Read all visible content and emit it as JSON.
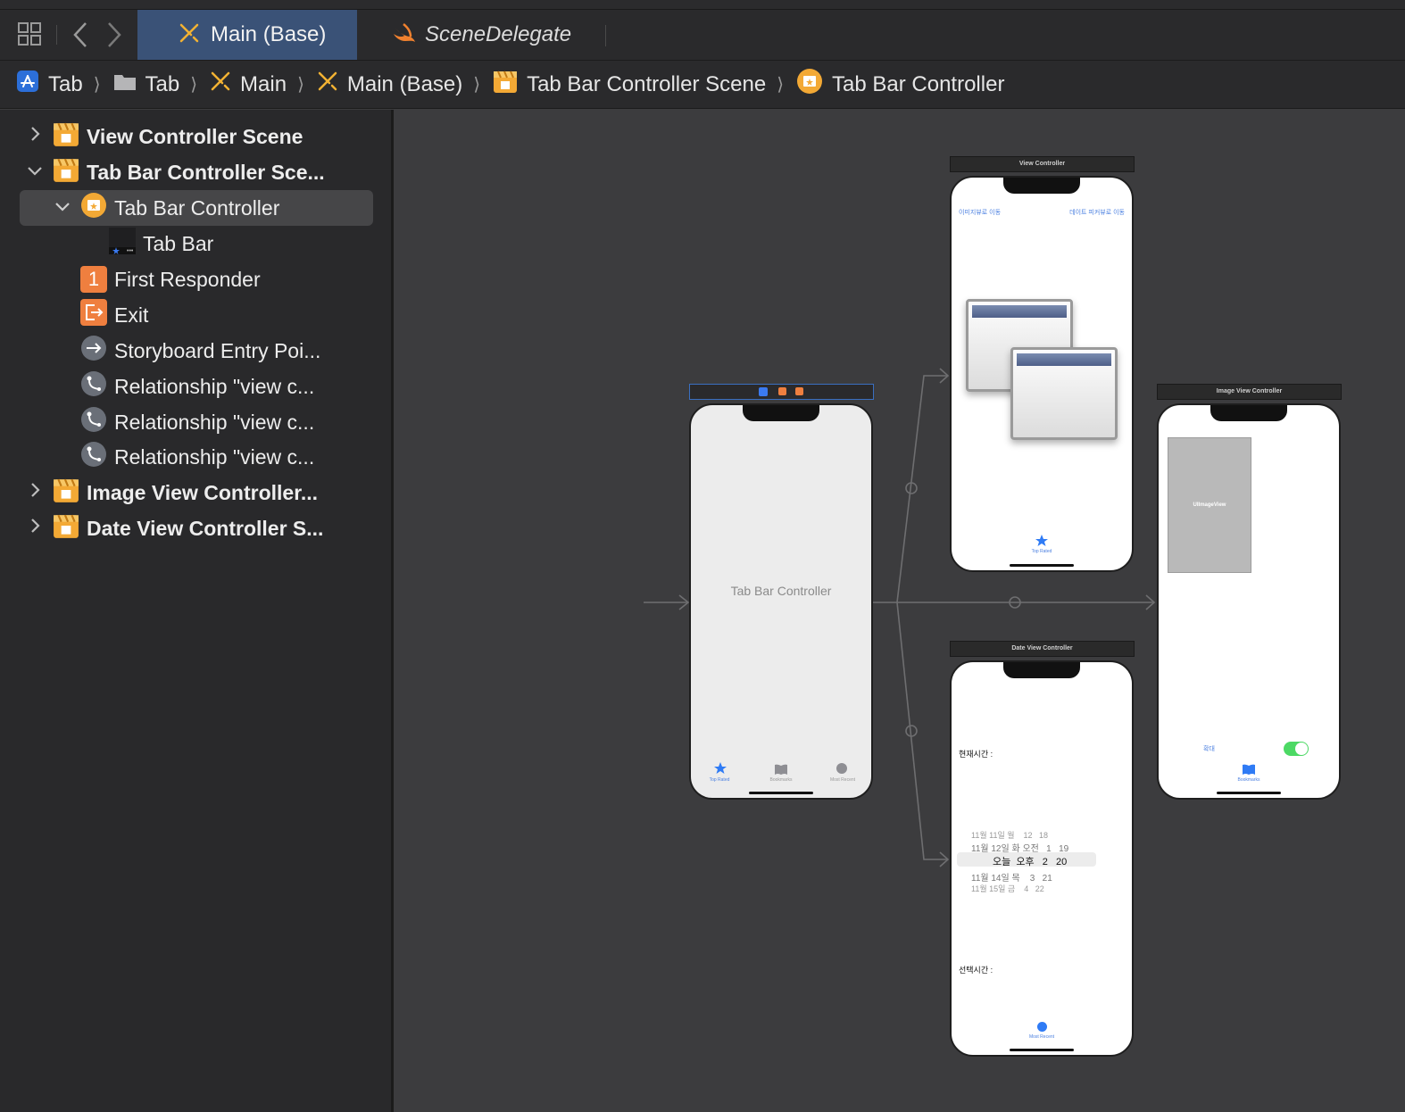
{
  "toolbar": {
    "tabs": [
      {
        "label": "Main (Base)",
        "active": true
      },
      {
        "label": "SceneDelegate",
        "active": false
      }
    ]
  },
  "breadcrumb": [
    {
      "label": "Tab",
      "icon": "app-icon"
    },
    {
      "label": "Tab",
      "icon": "folder-icon"
    },
    {
      "label": "Main",
      "icon": "storyboard-icon"
    },
    {
      "label": "Main (Base)",
      "icon": "storyboard-icon"
    },
    {
      "label": "Tab Bar Controller Scene",
      "icon": "scene-icon"
    },
    {
      "label": "Tab Bar Controller",
      "icon": "tab-bar-controller-icon"
    }
  ],
  "outline": {
    "items": [
      {
        "label": "View Controller Scene"
      },
      {
        "label": "Tab Bar Controller Sce..."
      },
      {
        "label": "Tab Bar Controller"
      },
      {
        "label": "Tab Bar"
      },
      {
        "label": "First Responder"
      },
      {
        "label": "Exit"
      },
      {
        "label": "Storyboard Entry Poi..."
      },
      {
        "label": "Relationship \"view c..."
      },
      {
        "label": "Relationship \"view c..."
      },
      {
        "label": "Relationship \"view c..."
      },
      {
        "label": "Image View Controller..."
      },
      {
        "label": "Date View Controller S..."
      }
    ],
    "first_responder_badge": "1"
  },
  "canvas": {
    "tab_bar_controller": {
      "title": "Tab Bar Controller",
      "tabs": [
        "Top Rated",
        "Bookmarks",
        "Most Recent"
      ]
    },
    "view_controller": {
      "scene_title": "View Controller",
      "left_link": "이미지뷰로 이동",
      "right_link": "데이트 피커뷰로 이동",
      "tab": "Top Rated"
    },
    "image_view_controller": {
      "scene_title": "Image View Controller",
      "image_label": "UIImageView",
      "zoom_label": "확대",
      "switch_on": true,
      "tab": "Bookmarks"
    },
    "date_view_controller": {
      "scene_title": "Date View Controller",
      "current_time_label": "현재시간 :",
      "selected_time_label": "선택시간 :",
      "picker_rows": [
        "11월 11일 월    12   18",
        "11월 12일 화 오전   1   19",
        "오늘  오후   2   20",
        "11월 14일 목    3   21",
        "11월 15일 금    4   22"
      ],
      "tab": "Most Recent"
    }
  },
  "colors": {
    "accent": "#3a5277",
    "canvas": "#3c3c3e",
    "sidebar": "#29292b",
    "ios_blue": "#2f7bf5",
    "switch_green": "#4cd964"
  }
}
